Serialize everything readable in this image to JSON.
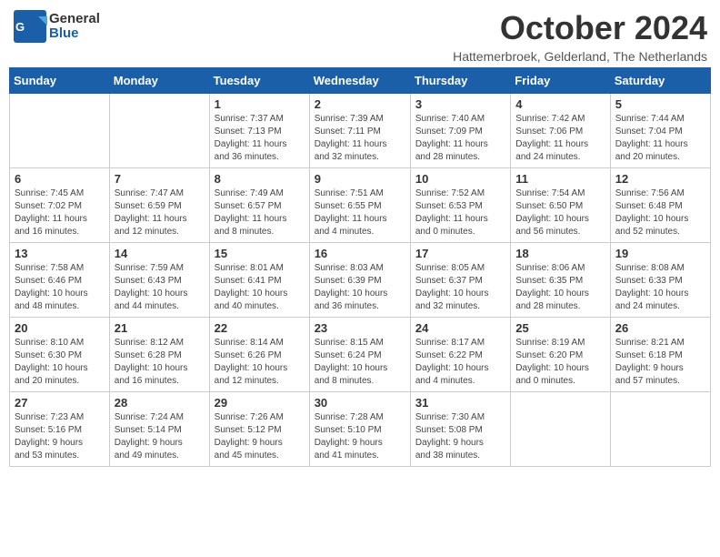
{
  "header": {
    "logo_general": "General",
    "logo_blue": "Blue",
    "month": "October 2024",
    "location": "Hattemerbroek, Gelderland, The Netherlands"
  },
  "weekdays": [
    "Sunday",
    "Monday",
    "Tuesday",
    "Wednesday",
    "Thursday",
    "Friday",
    "Saturday"
  ],
  "weeks": [
    [
      {
        "day": "",
        "info": ""
      },
      {
        "day": "",
        "info": ""
      },
      {
        "day": "1",
        "info": "Sunrise: 7:37 AM\nSunset: 7:13 PM\nDaylight: 11 hours\nand 36 minutes."
      },
      {
        "day": "2",
        "info": "Sunrise: 7:39 AM\nSunset: 7:11 PM\nDaylight: 11 hours\nand 32 minutes."
      },
      {
        "day": "3",
        "info": "Sunrise: 7:40 AM\nSunset: 7:09 PM\nDaylight: 11 hours\nand 28 minutes."
      },
      {
        "day": "4",
        "info": "Sunrise: 7:42 AM\nSunset: 7:06 PM\nDaylight: 11 hours\nand 24 minutes."
      },
      {
        "day": "5",
        "info": "Sunrise: 7:44 AM\nSunset: 7:04 PM\nDaylight: 11 hours\nand 20 minutes."
      }
    ],
    [
      {
        "day": "6",
        "info": "Sunrise: 7:45 AM\nSunset: 7:02 PM\nDaylight: 11 hours\nand 16 minutes."
      },
      {
        "day": "7",
        "info": "Sunrise: 7:47 AM\nSunset: 6:59 PM\nDaylight: 11 hours\nand 12 minutes."
      },
      {
        "day": "8",
        "info": "Sunrise: 7:49 AM\nSunset: 6:57 PM\nDaylight: 11 hours\nand 8 minutes."
      },
      {
        "day": "9",
        "info": "Sunrise: 7:51 AM\nSunset: 6:55 PM\nDaylight: 11 hours\nand 4 minutes."
      },
      {
        "day": "10",
        "info": "Sunrise: 7:52 AM\nSunset: 6:53 PM\nDaylight: 11 hours\nand 0 minutes."
      },
      {
        "day": "11",
        "info": "Sunrise: 7:54 AM\nSunset: 6:50 PM\nDaylight: 10 hours\nand 56 minutes."
      },
      {
        "day": "12",
        "info": "Sunrise: 7:56 AM\nSunset: 6:48 PM\nDaylight: 10 hours\nand 52 minutes."
      }
    ],
    [
      {
        "day": "13",
        "info": "Sunrise: 7:58 AM\nSunset: 6:46 PM\nDaylight: 10 hours\nand 48 minutes."
      },
      {
        "day": "14",
        "info": "Sunrise: 7:59 AM\nSunset: 6:43 PM\nDaylight: 10 hours\nand 44 minutes."
      },
      {
        "day": "15",
        "info": "Sunrise: 8:01 AM\nSunset: 6:41 PM\nDaylight: 10 hours\nand 40 minutes."
      },
      {
        "day": "16",
        "info": "Sunrise: 8:03 AM\nSunset: 6:39 PM\nDaylight: 10 hours\nand 36 minutes."
      },
      {
        "day": "17",
        "info": "Sunrise: 8:05 AM\nSunset: 6:37 PM\nDaylight: 10 hours\nand 32 minutes."
      },
      {
        "day": "18",
        "info": "Sunrise: 8:06 AM\nSunset: 6:35 PM\nDaylight: 10 hours\nand 28 minutes."
      },
      {
        "day": "19",
        "info": "Sunrise: 8:08 AM\nSunset: 6:33 PM\nDaylight: 10 hours\nand 24 minutes."
      }
    ],
    [
      {
        "day": "20",
        "info": "Sunrise: 8:10 AM\nSunset: 6:30 PM\nDaylight: 10 hours\nand 20 minutes."
      },
      {
        "day": "21",
        "info": "Sunrise: 8:12 AM\nSunset: 6:28 PM\nDaylight: 10 hours\nand 16 minutes."
      },
      {
        "day": "22",
        "info": "Sunrise: 8:14 AM\nSunset: 6:26 PM\nDaylight: 10 hours\nand 12 minutes."
      },
      {
        "day": "23",
        "info": "Sunrise: 8:15 AM\nSunset: 6:24 PM\nDaylight: 10 hours\nand 8 minutes."
      },
      {
        "day": "24",
        "info": "Sunrise: 8:17 AM\nSunset: 6:22 PM\nDaylight: 10 hours\nand 4 minutes."
      },
      {
        "day": "25",
        "info": "Sunrise: 8:19 AM\nSunset: 6:20 PM\nDaylight: 10 hours\nand 0 minutes."
      },
      {
        "day": "26",
        "info": "Sunrise: 8:21 AM\nSunset: 6:18 PM\nDaylight: 9 hours\nand 57 minutes."
      }
    ],
    [
      {
        "day": "27",
        "info": "Sunrise: 7:23 AM\nSunset: 5:16 PM\nDaylight: 9 hours\nand 53 minutes."
      },
      {
        "day": "28",
        "info": "Sunrise: 7:24 AM\nSunset: 5:14 PM\nDaylight: 9 hours\nand 49 minutes."
      },
      {
        "day": "29",
        "info": "Sunrise: 7:26 AM\nSunset: 5:12 PM\nDaylight: 9 hours\nand 45 minutes."
      },
      {
        "day": "30",
        "info": "Sunrise: 7:28 AM\nSunset: 5:10 PM\nDaylight: 9 hours\nand 41 minutes."
      },
      {
        "day": "31",
        "info": "Sunrise: 7:30 AM\nSunset: 5:08 PM\nDaylight: 9 hours\nand 38 minutes."
      },
      {
        "day": "",
        "info": ""
      },
      {
        "day": "",
        "info": ""
      }
    ]
  ]
}
